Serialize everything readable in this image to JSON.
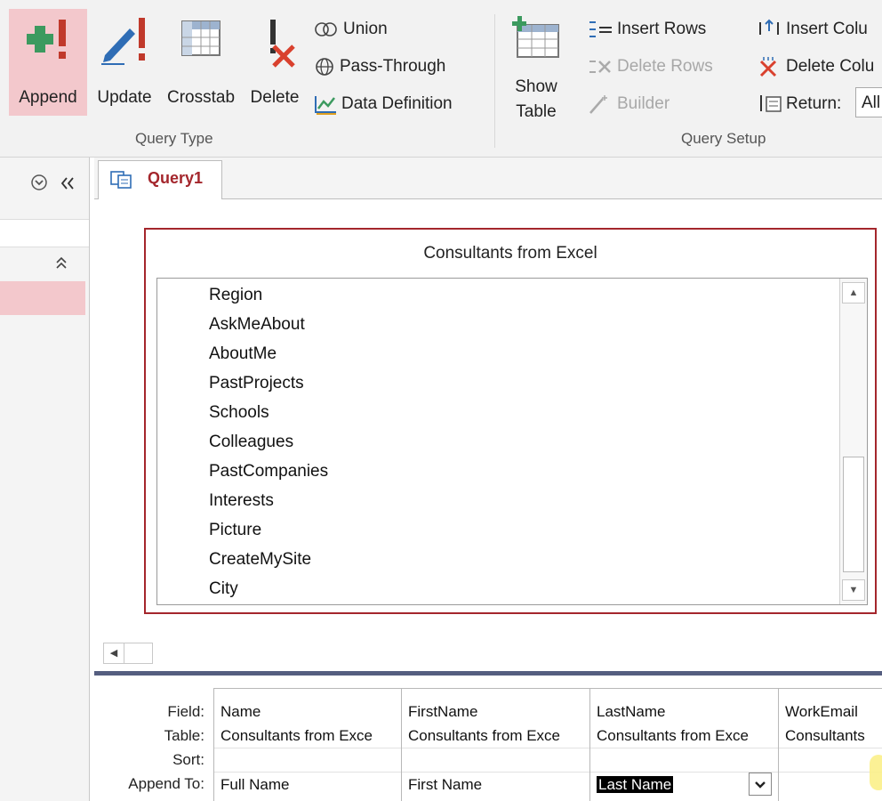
{
  "ribbon": {
    "query_type": {
      "group_label": "Query Type",
      "append_label": "Append",
      "update_label": "Update",
      "crosstab_label": "Crosstab",
      "delete_label": "Delete",
      "union_label": "Union",
      "passthrough_label": "Pass-Through",
      "datadef_label": "Data Definition"
    },
    "query_setup": {
      "group_label": "Query Setup",
      "showtable_line1": "Show",
      "showtable_line2": "Table",
      "insert_rows_label": "Insert Rows",
      "delete_rows_label": "Delete Rows",
      "builder_label": "Builder",
      "insert_columns_label": "Insert Colu",
      "delete_columns_label": "Delete Colu",
      "return_label": "Return:",
      "return_value": "All"
    }
  },
  "tab": {
    "title": "Query1"
  },
  "table": {
    "title": "Consultants from Excel",
    "fields": [
      "Region",
      "AskMeAbout",
      "AboutMe",
      "PastProjects",
      "Schools",
      "Colleagues",
      "PastCompanies",
      "Interests",
      "Picture",
      "CreateMySite",
      "City"
    ]
  },
  "grid": {
    "row_labels": {
      "field": "Field:",
      "table": "Table:",
      "sort": "Sort:",
      "append_to": "Append To:"
    },
    "columns": [
      {
        "field": "Name",
        "table": "Consultants from Exce",
        "append_to": "Full Name"
      },
      {
        "field": "FirstName",
        "table": "Consultants from Exce",
        "append_to": "First Name"
      },
      {
        "field": "LastName",
        "table": "Consultants from Exce",
        "append_to": "Last Name"
      },
      {
        "field": "WorkEmail",
        "table": "Consultants",
        "append_to": ""
      }
    ]
  },
  "colors": {
    "accent": "#a4262c",
    "selected_bg": "#f3c8cc",
    "splitter": "#555e80"
  }
}
